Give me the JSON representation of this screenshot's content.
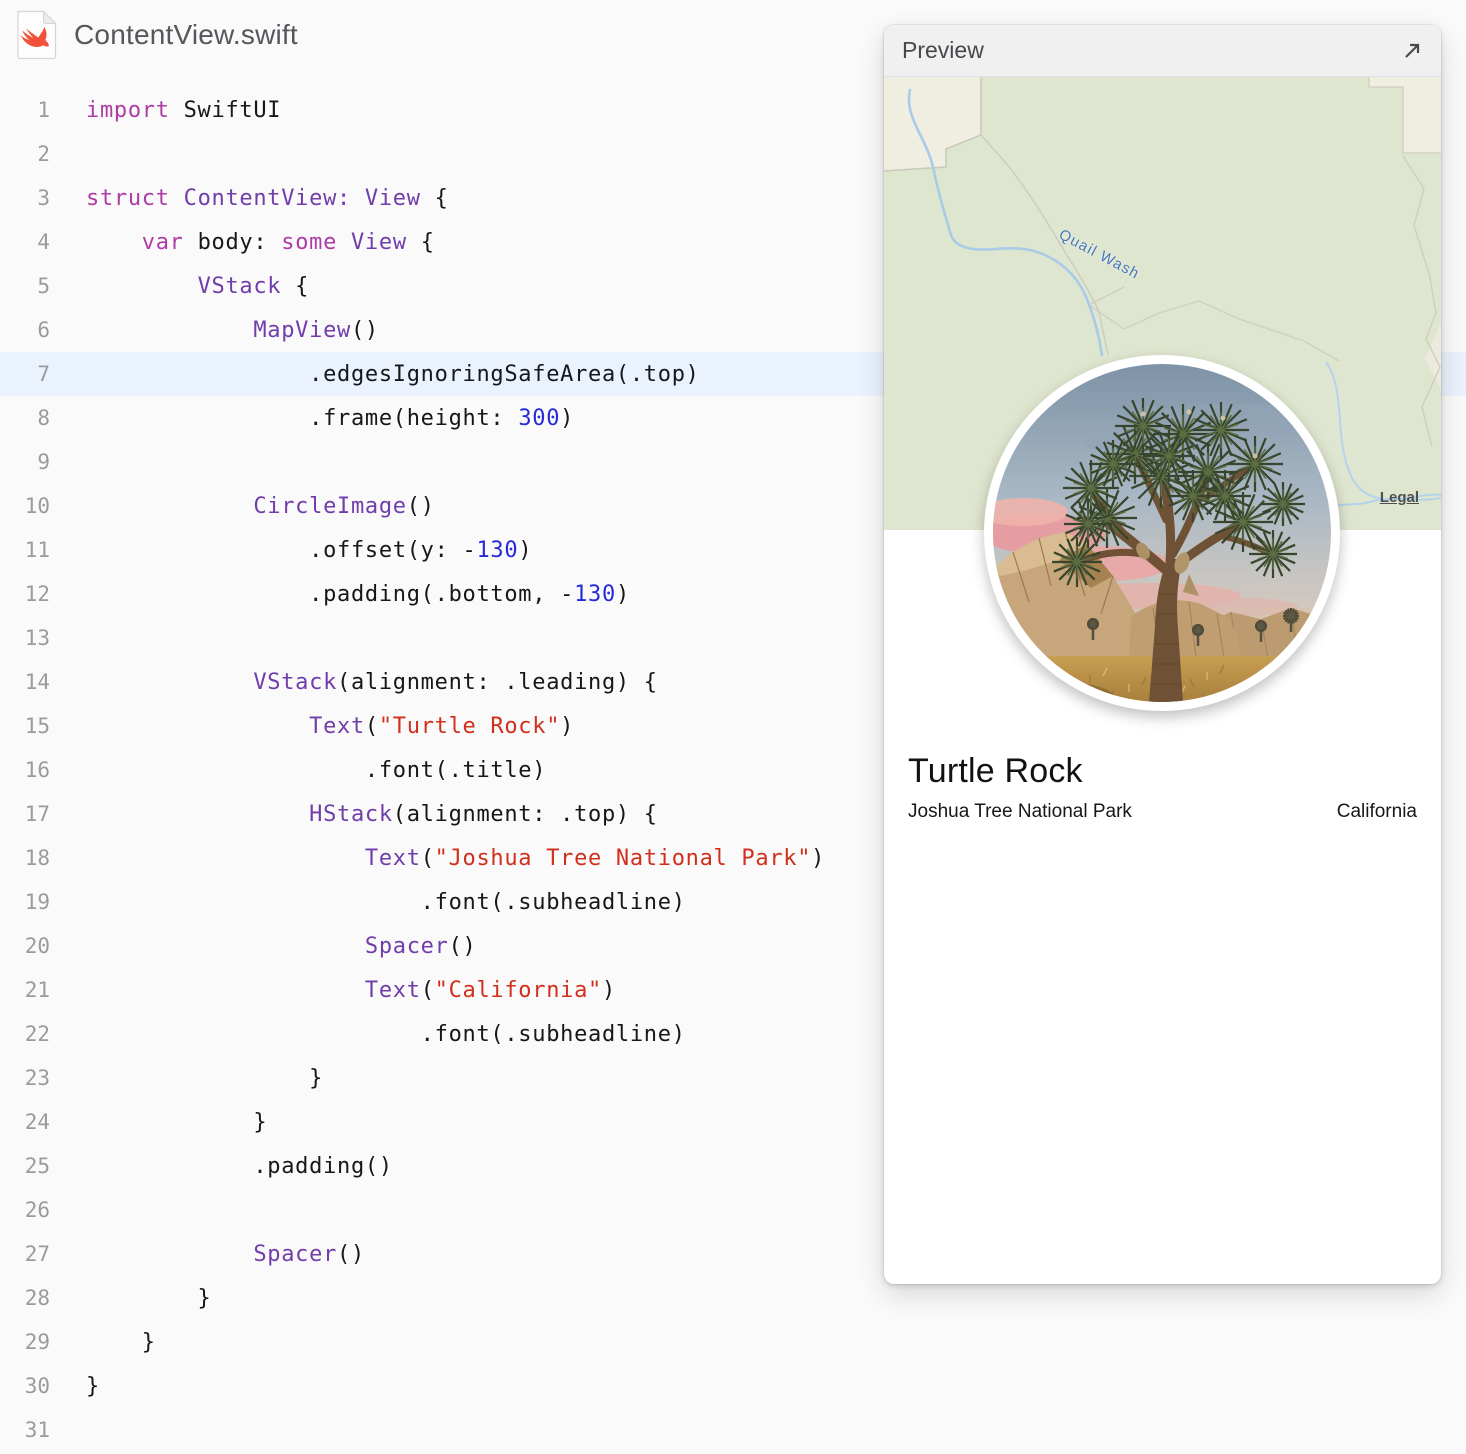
{
  "file_header": {
    "title": "ContentView.swift",
    "icon": "swift-file"
  },
  "code": {
    "highlight_line": 7,
    "lines": [
      {
        "n": 1,
        "segs": [
          [
            "k",
            "import"
          ],
          [
            "p",
            " SwiftUI"
          ]
        ]
      },
      {
        "n": 2,
        "segs": []
      },
      {
        "n": 3,
        "segs": [
          [
            "k",
            "struct"
          ],
          [
            "p",
            " "
          ],
          [
            "t",
            "ContentView:"
          ],
          [
            "p",
            " "
          ],
          [
            "t",
            "View"
          ],
          [
            "p",
            " {"
          ]
        ]
      },
      {
        "n": 4,
        "segs": [
          [
            "p",
            "    "
          ],
          [
            "k",
            "var"
          ],
          [
            "p",
            " body: "
          ],
          [
            "k",
            "some"
          ],
          [
            "p",
            " "
          ],
          [
            "t",
            "View"
          ],
          [
            "p",
            " {"
          ]
        ]
      },
      {
        "n": 5,
        "segs": [
          [
            "p",
            "        "
          ],
          [
            "t",
            "VStack"
          ],
          [
            "p",
            " {"
          ]
        ]
      },
      {
        "n": 6,
        "segs": [
          [
            "p",
            "            "
          ],
          [
            "t",
            "MapView"
          ],
          [
            "p",
            "()"
          ]
        ]
      },
      {
        "n": 7,
        "segs": [
          [
            "p",
            "                .edgesIgnoringSafeArea(.top)"
          ]
        ]
      },
      {
        "n": 8,
        "segs": [
          [
            "p",
            "                .frame(height: "
          ],
          [
            "n2",
            "300"
          ],
          [
            "p",
            ")"
          ]
        ]
      },
      {
        "n": 9,
        "segs": []
      },
      {
        "n": 10,
        "segs": [
          [
            "p",
            "            "
          ],
          [
            "t",
            "CircleImage"
          ],
          [
            "p",
            "()"
          ]
        ]
      },
      {
        "n": 11,
        "segs": [
          [
            "p",
            "                .offset(y: -"
          ],
          [
            "n2",
            "130"
          ],
          [
            "p",
            ")"
          ]
        ]
      },
      {
        "n": 12,
        "segs": [
          [
            "p",
            "                .padding(.bottom, -"
          ],
          [
            "n2",
            "130"
          ],
          [
            "p",
            ")"
          ]
        ]
      },
      {
        "n": 13,
        "segs": []
      },
      {
        "n": 14,
        "segs": [
          [
            "p",
            "            "
          ],
          [
            "t",
            "VStack"
          ],
          [
            "p",
            "(alignment: .leading) {"
          ]
        ]
      },
      {
        "n": 15,
        "segs": [
          [
            "p",
            "                "
          ],
          [
            "t",
            "Text"
          ],
          [
            "p",
            "("
          ],
          [
            "s",
            "\"Turtle Rock\""
          ],
          [
            "p",
            ")"
          ]
        ]
      },
      {
        "n": 16,
        "segs": [
          [
            "p",
            "                    .font(.title)"
          ]
        ]
      },
      {
        "n": 17,
        "segs": [
          [
            "p",
            "                "
          ],
          [
            "t",
            "HStack"
          ],
          [
            "p",
            "(alignment: .top) {"
          ]
        ]
      },
      {
        "n": 18,
        "segs": [
          [
            "p",
            "                    "
          ],
          [
            "t",
            "Text"
          ],
          [
            "p",
            "("
          ],
          [
            "s",
            "\"Joshua Tree National Park\""
          ],
          [
            "p",
            ")"
          ]
        ]
      },
      {
        "n": 19,
        "segs": [
          [
            "p",
            "                        .font(.subheadline)"
          ]
        ]
      },
      {
        "n": 20,
        "segs": [
          [
            "p",
            "                    "
          ],
          [
            "t",
            "Spacer"
          ],
          [
            "p",
            "()"
          ]
        ]
      },
      {
        "n": 21,
        "segs": [
          [
            "p",
            "                    "
          ],
          [
            "t",
            "Text"
          ],
          [
            "p",
            "("
          ],
          [
            "s",
            "\"California\""
          ],
          [
            "p",
            ")"
          ]
        ]
      },
      {
        "n": 22,
        "segs": [
          [
            "p",
            "                        .font(.subheadline)"
          ]
        ]
      },
      {
        "n": 23,
        "segs": [
          [
            "p",
            "                }"
          ]
        ]
      },
      {
        "n": 24,
        "segs": [
          [
            "p",
            "            }"
          ]
        ]
      },
      {
        "n": 25,
        "segs": [
          [
            "p",
            "            .padding()"
          ]
        ]
      },
      {
        "n": 26,
        "segs": []
      },
      {
        "n": 27,
        "segs": [
          [
            "p",
            "            "
          ],
          [
            "t",
            "Spacer"
          ],
          [
            "p",
            "()"
          ]
        ]
      },
      {
        "n": 28,
        "segs": [
          [
            "p",
            "        }"
          ]
        ]
      },
      {
        "n": 29,
        "segs": [
          [
            "p",
            "    }"
          ]
        ]
      },
      {
        "n": 30,
        "segs": [
          [
            "p",
            "}"
          ]
        ]
      },
      {
        "n": 31,
        "segs": []
      }
    ]
  },
  "preview": {
    "header": {
      "title": "Preview",
      "expand_icon": "arrow-up-right"
    },
    "map": {
      "stream_label": "Quail Wash",
      "legal_link": "Legal"
    },
    "card": {
      "title": "Turtle Rock",
      "park": "Joshua Tree National Park",
      "state": "California"
    }
  },
  "colors": {
    "page_bg": "#FAFAFA",
    "keyword": "#AD3DA4",
    "type": "#703DAA",
    "number": "#272AD8",
    "string": "#D12F1B",
    "code_text": "#17171A",
    "line_number": "#9B9B9F",
    "highlight_row": "#EAF2FD",
    "panel_header_bg": "#F0F0F1",
    "map_green": "#DFE6CF",
    "map_beige": "#F0EDE1",
    "stream_blue": "#A8CBE8",
    "stream_label_blue": "#4278B8",
    "swift_orange": "#F05138"
  }
}
